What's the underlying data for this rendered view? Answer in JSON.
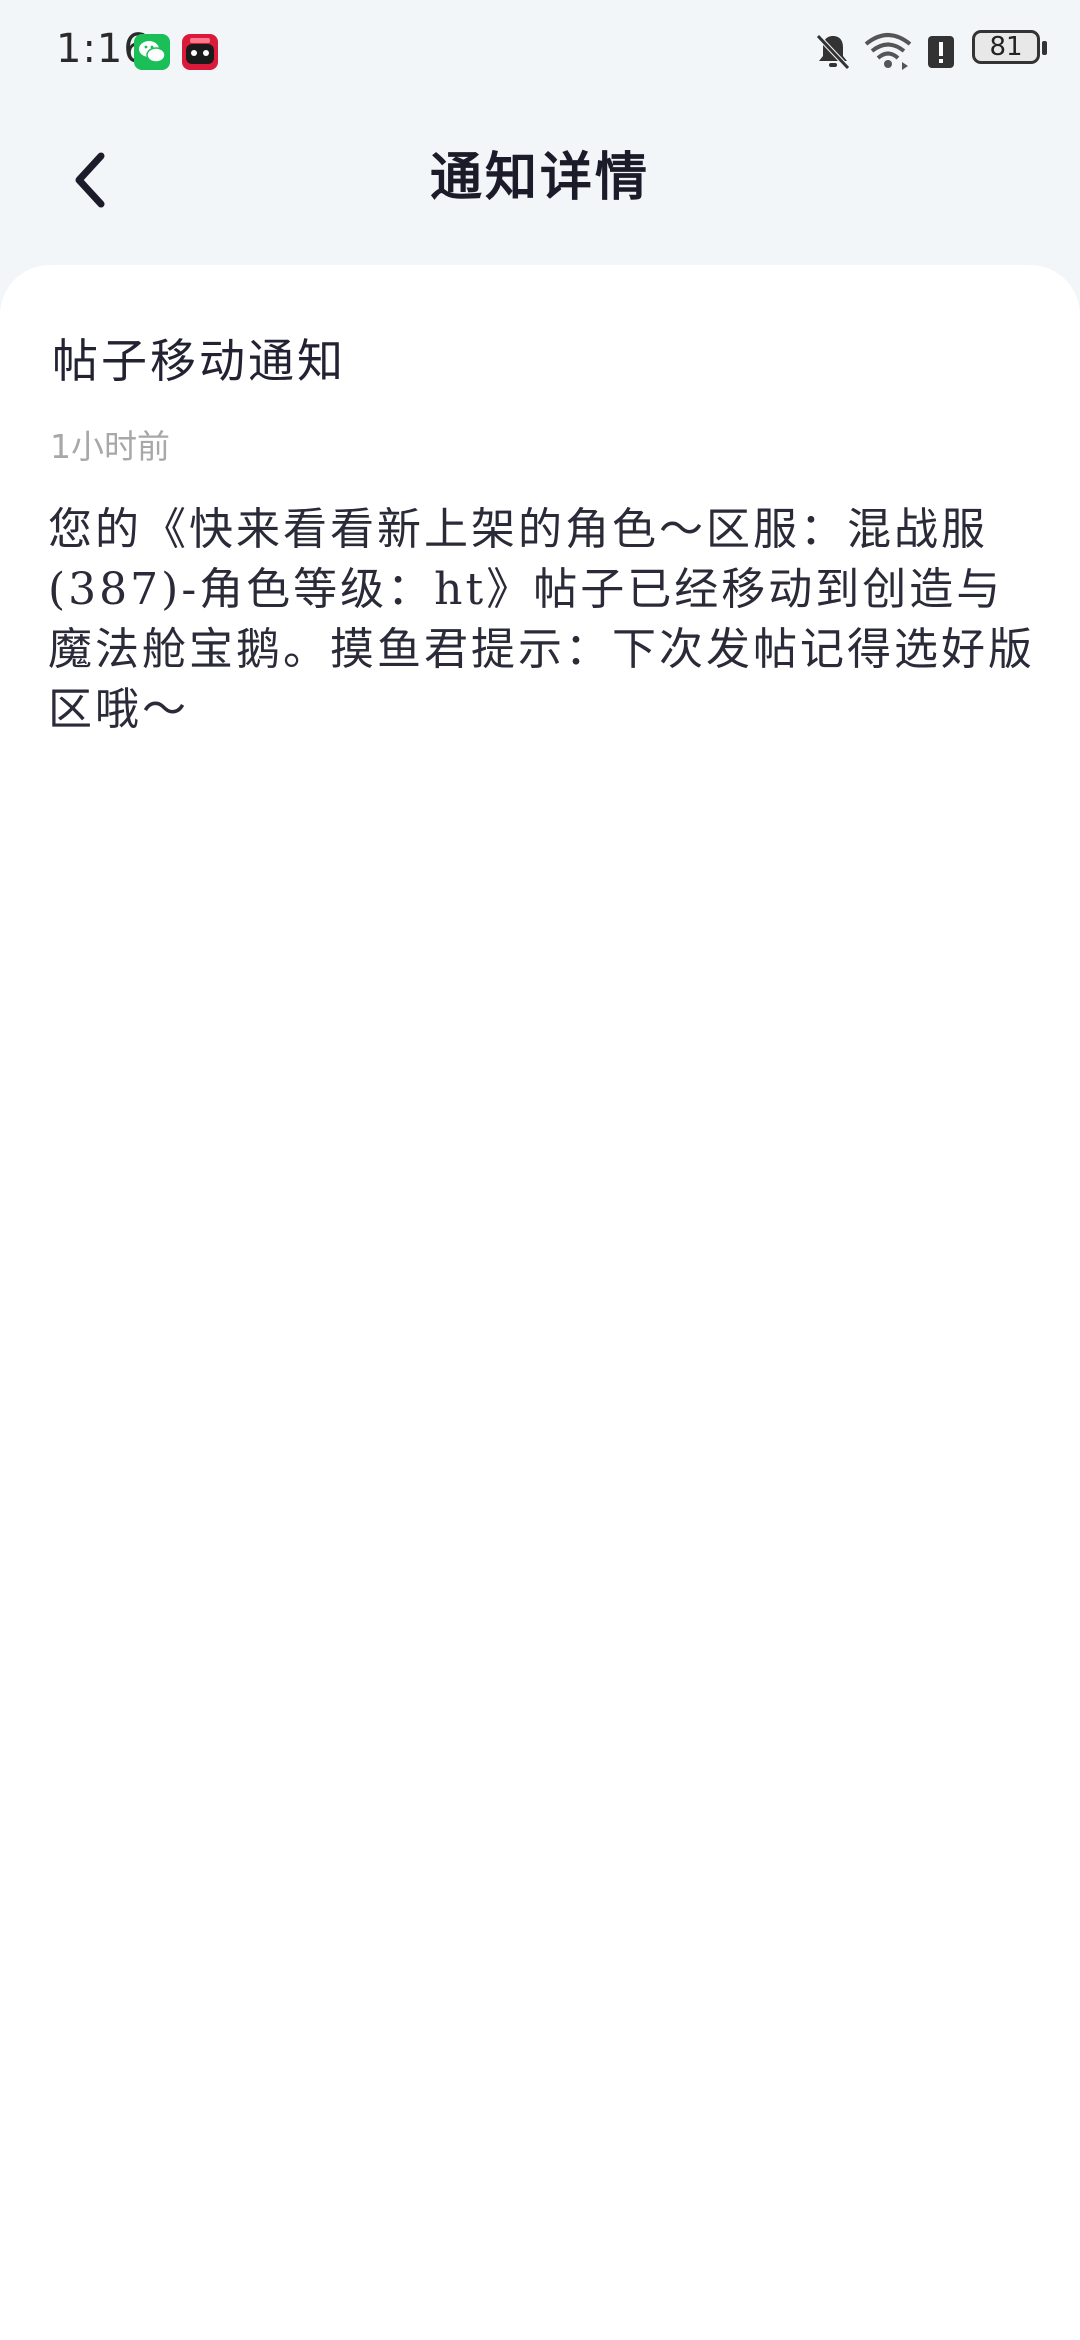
{
  "status_bar": {
    "time": "1:16",
    "battery_level": "81",
    "icons": [
      "wechat-icon",
      "game-app-icon",
      "bell-muted-icon",
      "wifi-icon",
      "alert-icon",
      "battery-icon"
    ]
  },
  "header": {
    "title": "通知详情",
    "back_icon": "chevron-left-icon"
  },
  "notice": {
    "title": "帖子移动通知",
    "time": "1小时前",
    "body": "您的《快来看看新上架的角色～区服：混战服(387)-角色等级：ht》帖子已经移动到创造与魔法舱宝鹅。摸鱼君提示：下次发帖记得选好版区哦～"
  },
  "colors": {
    "page_background": "#f2f6f9",
    "card_background": "#ffffff",
    "title_text": "#1b1b2a",
    "muted_text": "#a8a8a8",
    "wechat_green": "#1bbf58"
  }
}
